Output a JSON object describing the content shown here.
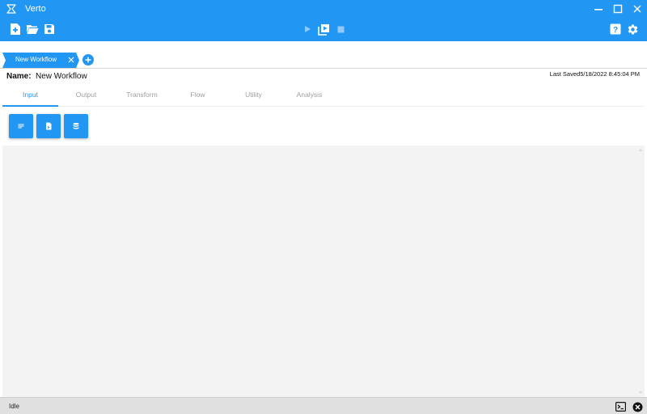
{
  "window": {
    "title": "Verto",
    "controls": [
      "minimize-icon",
      "maximize-icon",
      "close-icon"
    ]
  },
  "toolbar": {
    "left_icons": [
      "new-file-icon",
      "open-folder-icon",
      "save-icon"
    ],
    "center_icons": [
      "play-icon",
      "step-run-icon",
      "stop-icon"
    ],
    "right_icons": [
      "help-icon",
      "gear-icon"
    ]
  },
  "workflow_tabs": [
    {
      "label": "New Workflow",
      "active": true
    }
  ],
  "workflow": {
    "name_label": "Name:",
    "name_value": "New Workflow",
    "last_saved_label": "Last Saved",
    "last_saved_value": "5/18/2022 8:45:04 PM"
  },
  "category_tabs": [
    {
      "label": "Input",
      "active": true
    },
    {
      "label": "Output",
      "active": false
    },
    {
      "label": "Transform",
      "active": false
    },
    {
      "label": "Flow",
      "active": false
    },
    {
      "label": "Utility",
      "active": false
    },
    {
      "label": "Analysis",
      "active": false
    }
  ],
  "input_nodes": [
    "text-input-icon",
    "file-input-icon",
    "database-input-icon"
  ],
  "status": {
    "text": "Idle",
    "icons": [
      "terminal-icon",
      "cancel-icon"
    ]
  },
  "colors": {
    "accent": "#2196f3",
    "canvas": "#f3f3f3",
    "statusbar": "#e0e0e0"
  }
}
